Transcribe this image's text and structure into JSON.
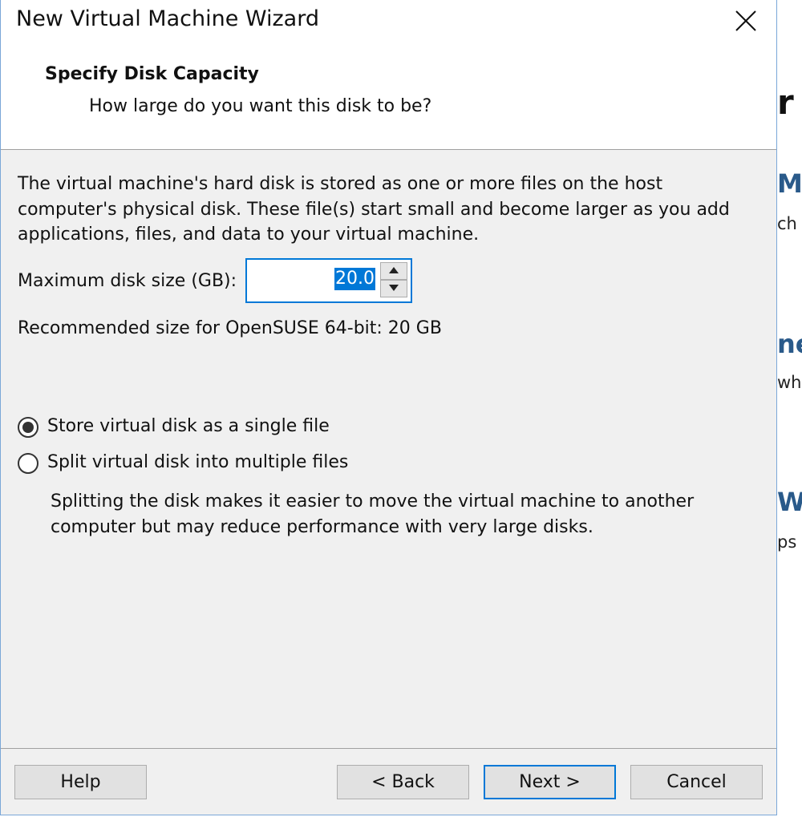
{
  "window": {
    "title": "New Virtual Machine Wizard"
  },
  "header": {
    "title": "Specify Disk Capacity",
    "subtitle": "How large do you want this disk to be?"
  },
  "content": {
    "description": "The virtual machine's hard disk is stored as one or more files on the host computer's physical disk. These file(s) start small and become larger as you add applications, files, and data to your virtual machine.",
    "max_size_label": "Maximum disk size (GB):",
    "max_size_value": "20.0",
    "recommended": "Recommended size for OpenSUSE 64-bit: 20 GB",
    "options": [
      {
        "label": "Store virtual disk as a single file",
        "selected": true
      },
      {
        "label": "Split virtual disk into multiple files",
        "selected": false
      }
    ],
    "split_note": "Splitting the disk makes it easier to move the virtual machine to another computer but may reduce performance with very large disks."
  },
  "buttons": {
    "help": "Help",
    "back": "< Back",
    "next": "Next >",
    "cancel": "Cancel"
  },
  "background_fragments": [
    "r",
    "Ma",
    "ch",
    "ne",
    "wh",
    "Wo",
    "ps"
  ],
  "colors": {
    "accent": "#0078d7",
    "dialog_bg": "#f0f0f0",
    "border": "#7aa7d8"
  }
}
